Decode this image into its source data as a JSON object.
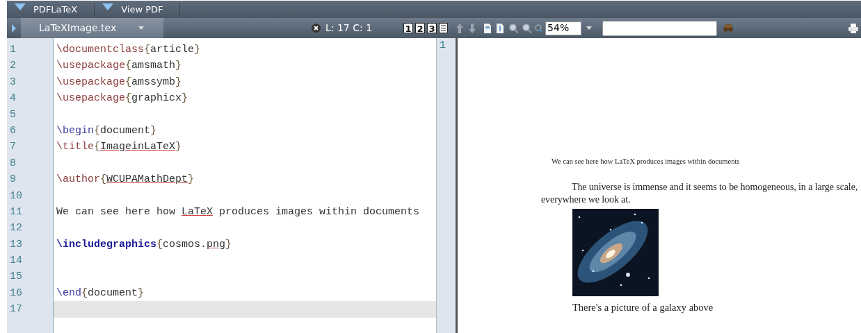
{
  "top_toolbar": {
    "buttons": [
      {
        "label": "PDFLaTeX"
      },
      {
        "label": "View PDF"
      }
    ]
  },
  "editor_toolbar": {
    "file_tab": "LaTeXImage.tex",
    "position": "L: 17 C: 1",
    "bookmarks": [
      "1",
      "2",
      "3"
    ],
    "zoom": "54%"
  },
  "editor": {
    "lines": [
      {
        "number": "1",
        "current": false,
        "tokens": [
          {
            "kind": "command",
            "text": "\\documentclass"
          },
          {
            "kind": "brace",
            "text": "{"
          },
          {
            "kind": "arg",
            "text": "article"
          },
          {
            "kind": "brace",
            "text": "}"
          }
        ]
      },
      {
        "number": "2",
        "current": false,
        "tokens": [
          {
            "kind": "command",
            "text": "\\usepackage"
          },
          {
            "kind": "brace",
            "text": "{"
          },
          {
            "kind": "arg",
            "text": "amsmath"
          },
          {
            "kind": "brace",
            "text": "}"
          }
        ]
      },
      {
        "number": "3",
        "current": false,
        "tokens": [
          {
            "kind": "command",
            "text": "\\usepackage"
          },
          {
            "kind": "brace",
            "text": "{"
          },
          {
            "kind": "arg",
            "text": "amssymb"
          },
          {
            "kind": "brace",
            "text": "}"
          }
        ]
      },
      {
        "number": "4",
        "current": false,
        "tokens": [
          {
            "kind": "command",
            "text": "\\usepackage"
          },
          {
            "kind": "brace",
            "text": "{"
          },
          {
            "kind": "arg",
            "text": "graphicx"
          },
          {
            "kind": "brace",
            "text": "}"
          }
        ]
      },
      {
        "number": "5",
        "current": false
      },
      {
        "number": "6",
        "current": false,
        "tokens": [
          {
            "kind": "env",
            "text": "\\begin"
          },
          {
            "kind": "brace",
            "text": "{"
          },
          {
            "kind": "arg",
            "text": "document"
          },
          {
            "kind": "brace",
            "text": "}"
          }
        ]
      },
      {
        "number": "7",
        "current": false,
        "tokens": [
          {
            "kind": "command",
            "text": "\\title"
          },
          {
            "kind": "brace",
            "text": "{"
          },
          {
            "kind": "misspelled",
            "text": "ImageinLaTeX"
          },
          {
            "kind": "brace",
            "text": "}"
          }
        ]
      },
      {
        "number": "8",
        "current": false
      },
      {
        "number": "9",
        "current": false,
        "tokens": [
          {
            "kind": "command",
            "text": "\\author"
          },
          {
            "kind": "brace",
            "text": "{"
          },
          {
            "kind": "misspelled",
            "text": "WCUPAMathDept"
          },
          {
            "kind": "brace",
            "text": "}"
          }
        ]
      },
      {
        "number": "10",
        "current": false
      },
      {
        "number": "11",
        "current": false,
        "tokens": [
          {
            "kind": "text",
            "text": "We can see here how "
          },
          {
            "kind": "misspelled",
            "text": "LaTeX"
          },
          {
            "kind": "text",
            "text": " produces images within documents"
          }
        ]
      },
      {
        "number": "12",
        "current": false
      },
      {
        "number": "13",
        "current": false,
        "tokens": [
          {
            "kind": "keyword",
            "text": "\\includegraphics"
          },
          {
            "kind": "brace",
            "text": "{"
          },
          {
            "kind": "arg",
            "text": "cosmos."
          },
          {
            "kind": "misspelled",
            "text": "png"
          },
          {
            "kind": "brace",
            "text": "}"
          }
        ]
      },
      {
        "number": "14",
        "current": false
      },
      {
        "number": "15",
        "current": false
      },
      {
        "number": "16",
        "current": false,
        "tokens": [
          {
            "kind": "env",
            "text": "\\end"
          },
          {
            "kind": "brace",
            "text": "{"
          },
          {
            "kind": "arg",
            "text": "document"
          },
          {
            "kind": "brace",
            "text": "}"
          }
        ]
      },
      {
        "number": "17",
        "current": true
      }
    ]
  },
  "preview": {
    "page_number": "1",
    "title_line": "We can see here how LaTeX produces images within documents",
    "paragraph": "The universe is immense and it seems to be homogeneous, in a large scale, everywhere we look at.",
    "caption": "There's a picture of a galaxy above"
  }
}
